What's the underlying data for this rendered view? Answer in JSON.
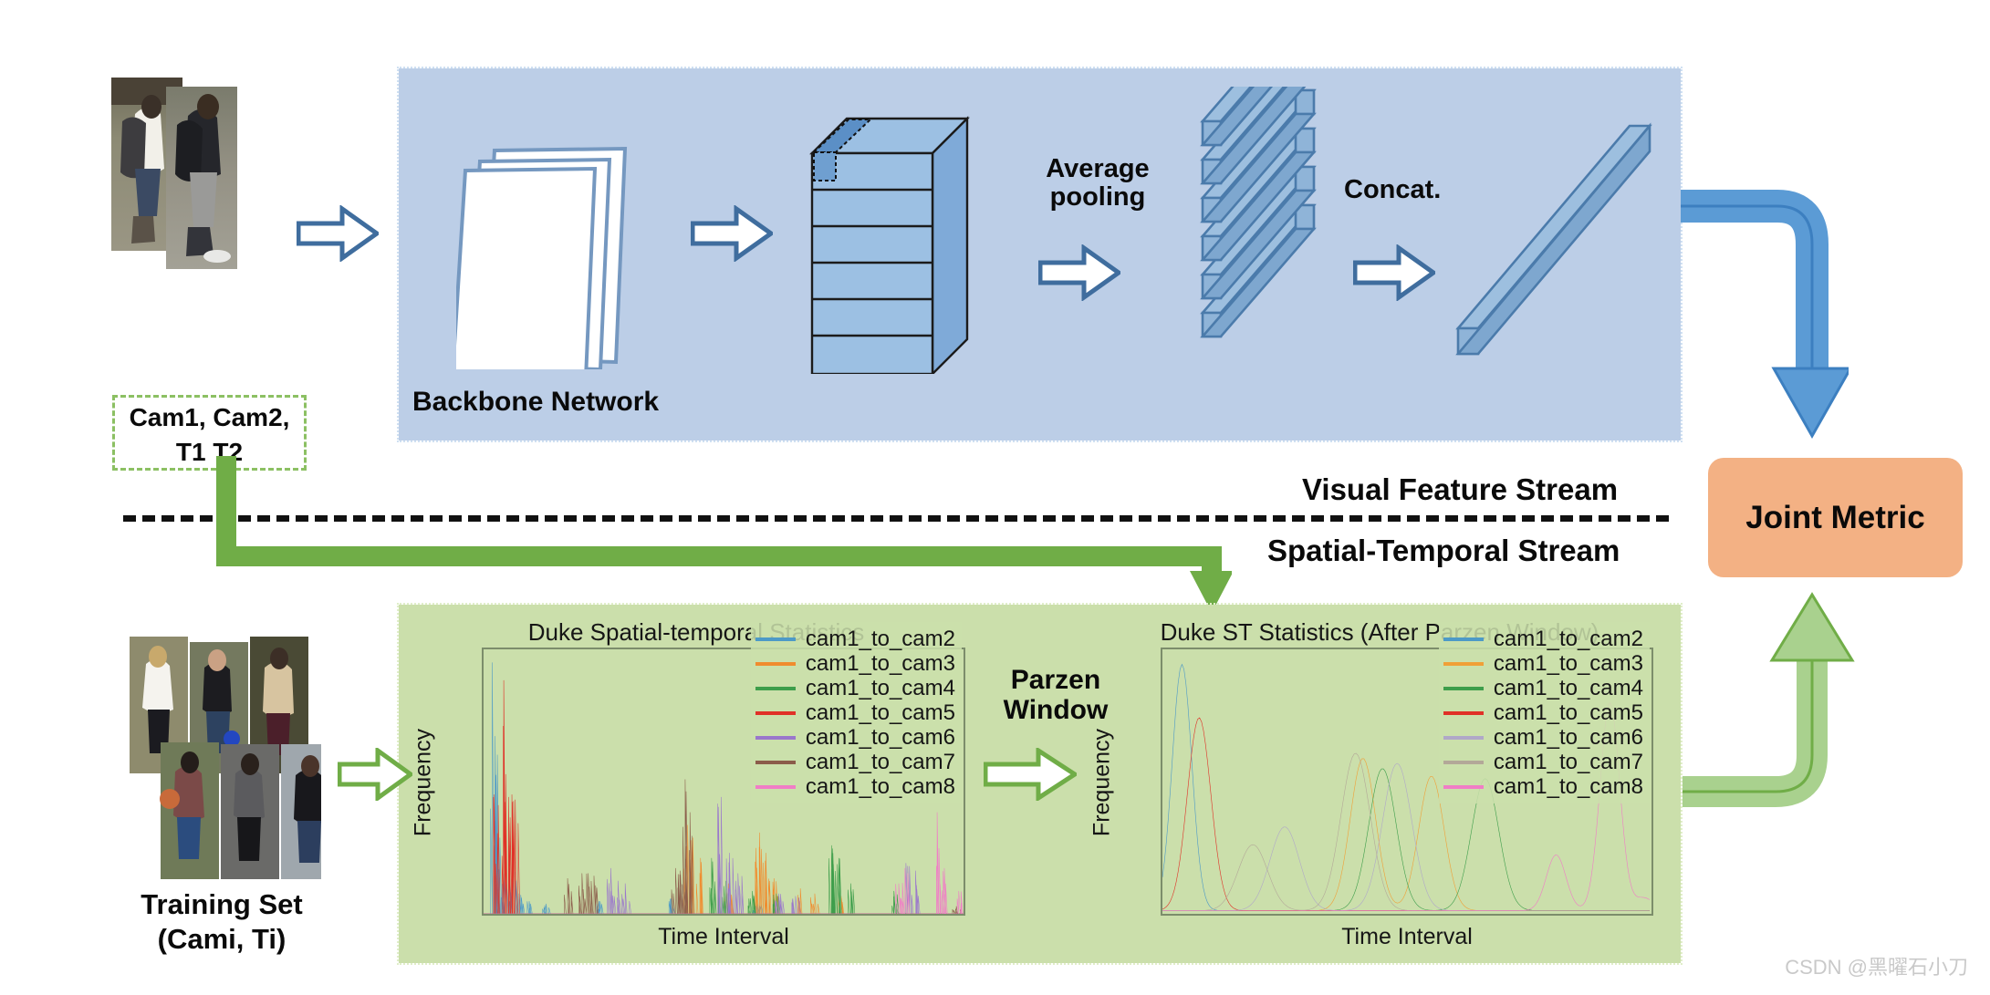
{
  "figure": {
    "watermark": "CSDN @黑曜石小刀"
  },
  "visual_stream": {
    "panel_color": "#bccee7",
    "backbone_label": "Backbone Network",
    "avg_pooling_label": "Average\npooling",
    "avg_pooling_line1": "Average",
    "avg_pooling_line2": "pooling",
    "concat_label": "Concat.",
    "stream_label": "Visual Feature Stream"
  },
  "input": {
    "cam_label_line1": "Cam1,  Cam2,",
    "cam_label_line2": "T1            T2",
    "box_border_color": "#8cc063"
  },
  "spatial_temporal_stream": {
    "panel_color": "#cbdfab",
    "stream_label": "Spatial-Temporal Stream",
    "training_set_line1": "Training Set",
    "training_set_line2": "(Cami, Ti)",
    "parzen_line1": "Parzen",
    "parzen_line2": "Window"
  },
  "joint_metric": {
    "label": "Joint Metric",
    "fill_color": "#f3b184"
  },
  "arrows": {
    "visual_to_joint_color": "#5b9bd5",
    "st_to_joint_color": "#a9d18e",
    "input_branch_color": "#70ad47",
    "hollow_blue_outline": "#3f6d9e",
    "hollow_green_outline": "#70ad47"
  },
  "chart_data": [
    {
      "type": "line",
      "id": "duke-raw",
      "title": "Duke Spatial-temporal Statistics",
      "xlabel": "Time Interval",
      "ylabel": "Frequency",
      "grid": false,
      "legend_position": "upper right",
      "xlim": [
        0,
        100
      ],
      "ylim": [
        0,
        1
      ],
      "series": [
        {
          "name": "cam1_to_cam2",
          "color": "#4d9ac7",
          "peaks": [
            [
              1.8,
              0.99
            ],
            [
              2.4,
              0.7
            ],
            [
              3.4,
              0.3
            ],
            [
              4.6,
              0.13
            ],
            [
              6.0,
              0.18
            ],
            [
              7.4,
              0.08
            ],
            [
              9.5,
              0.05
            ],
            [
              13.0,
              0.04
            ],
            [
              24.0,
              0.05
            ],
            [
              39.0,
              0.06
            ],
            [
              57.0,
              0.04
            ]
          ]
        },
        {
          "name": "cam1_to_cam3",
          "color": "#f08c2e",
          "peaks": [
            [
              42.5,
              0.35
            ],
            [
              43.6,
              0.3
            ],
            [
              45.2,
              0.22
            ],
            [
              51.0,
              0.12
            ],
            [
              57.5,
              0.32
            ],
            [
              58.8,
              0.24
            ],
            [
              60.5,
              0.14
            ],
            [
              66.0,
              0.1
            ],
            [
              69.0,
              0.08
            ],
            [
              74.5,
              0.07
            ]
          ]
        },
        {
          "name": "cam1_to_cam4",
          "color": "#3e9e4b",
          "peaks": [
            [
              47.5,
              0.22
            ],
            [
              49.0,
              0.17
            ],
            [
              50.5,
              0.13
            ],
            [
              56.0,
              0.09
            ],
            [
              61.0,
              0.08
            ],
            [
              72.5,
              0.27
            ],
            [
              74.0,
              0.22
            ],
            [
              76.5,
              0.12
            ],
            [
              85.5,
              0.09
            ]
          ]
        },
        {
          "name": "cam1_to_cam5",
          "color": "#e03127",
          "peaks": [
            [
              4.2,
              0.92
            ],
            [
              4.6,
              0.55
            ],
            [
              5.2,
              0.46
            ],
            [
              5.9,
              0.47
            ],
            [
              6.6,
              0.45
            ],
            [
              2.2,
              0.47
            ]
          ]
        },
        {
          "name": "cam1_to_cam6",
          "color": "#9a77cc",
          "peaks": [
            [
              26.5,
              0.18
            ],
            [
              28.0,
              0.13
            ],
            [
              29.5,
              0.12
            ],
            [
              49.5,
              0.46
            ],
            [
              51.2,
              0.24
            ],
            [
              53.0,
              0.16
            ],
            [
              61.5,
              0.08
            ],
            [
              65.0,
              0.07
            ],
            [
              88.0,
              0.2
            ],
            [
              90.0,
              0.17
            ]
          ]
        },
        {
          "name": "cam1_to_cam7",
          "color": "#8b5c4a",
          "peaks": [
            [
              17.5,
              0.14
            ],
            [
              20.5,
              0.16
            ],
            [
              21.8,
              0.16
            ],
            [
              23.0,
              0.15
            ],
            [
              42.0,
              0.53
            ],
            [
              43.0,
              0.4
            ],
            [
              40.0,
              0.18
            ],
            [
              41.0,
              0.17
            ],
            [
              98.5,
              0.03
            ]
          ]
        },
        {
          "name": "cam1_to_cam8",
          "color": "#f07ec6",
          "peaks": [
            [
              86.5,
              0.12
            ],
            [
              87.8,
              0.18
            ],
            [
              94.5,
              0.4
            ],
            [
              96.0,
              0.18
            ],
            [
              99.0,
              0.09
            ]
          ]
        }
      ]
    },
    {
      "type": "line",
      "id": "duke-parzen",
      "title": "Duke ST Statistics (After Parzen Window)",
      "xlabel": "Time Interval",
      "ylabel": "Frequency",
      "grid": false,
      "legend_position": "upper right",
      "xlim": [
        0,
        100
      ],
      "ylim": [
        0,
        1
      ],
      "series": [
        {
          "name": "cam1_to_cam2",
          "color": "#4d9ac7",
          "peaks": [
            [
              4.0,
              0.97
            ]
          ],
          "width": 2.0
        },
        {
          "name": "cam1_to_cam3",
          "color": "#f0a037",
          "peaks": [
            [
              41.0,
              0.6
            ],
            [
              55.0,
              0.53
            ]
          ],
          "width": 2.6
        },
        {
          "name": "cam1_to_cam4",
          "color": "#3e9e4b",
          "peaks": [
            [
              45.0,
              0.56
            ],
            [
              66.0,
              0.52
            ]
          ],
          "width": 2.8
        },
        {
          "name": "cam1_to_cam5",
          "color": "#e03127",
          "peaks": [
            [
              7.5,
              0.76
            ]
          ],
          "width": 2.4
        },
        {
          "name": "cam1_to_cam6",
          "color": "#b0a8c8",
          "peaks": [
            [
              25.0,
              0.33
            ],
            [
              48.0,
              0.58
            ]
          ],
          "width": 3.0
        },
        {
          "name": "cam1_to_cam7",
          "color": "#b3a898",
          "peaks": [
            [
              18.5,
              0.26
            ],
            [
              39.5,
              0.62
            ]
          ],
          "width": 3.0
        },
        {
          "name": "cam1_to_cam8",
          "color": "#f07ec6",
          "peaks": [
            [
              80.5,
              0.22
            ],
            [
              91.5,
              0.82
            ],
            [
              98.5,
              0.05
            ]
          ],
          "width": 2.0
        }
      ]
    }
  ]
}
